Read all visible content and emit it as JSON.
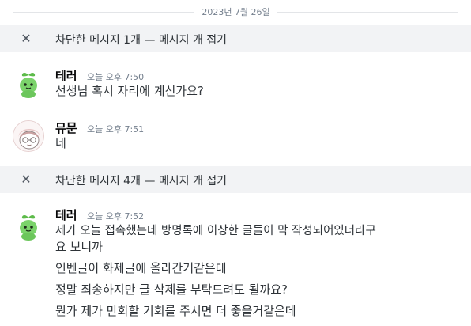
{
  "date_divider": "2023년 7월 26일",
  "blocked_1": {
    "text": "차단한 메시지 1개 — 메시지 개 접기"
  },
  "message_1": {
    "author": "테러",
    "timestamp": "오늘 오후 7:50",
    "lines": [
      "선생님 혹시 자리에 계신가요?"
    ],
    "avatar_icon": "green-sprout-avatar-icon"
  },
  "message_2": {
    "author": "뮤문",
    "timestamp": "오늘 오후 7:51",
    "lines": [
      "네"
    ],
    "avatar_icon": "sketch-character-avatar-icon"
  },
  "blocked_2": {
    "text": "차단한 메시지 4개 — 메시지 개 접기"
  },
  "message_3": {
    "author": "테러",
    "timestamp": "오늘 오후 7:52",
    "lines": [
      "제가 오늘 접속했는데 방명록에 이상한 글들이 막 작성되어있더라구",
      "요 보니까",
      "인벤글이 화제글에 올라간거같은데",
      "정말 죄송하지만 글 삭제를 부탁드려도 될까요?",
      "뭔가 제가 만회할 기회를 주시면 더 좋을거같은데"
    ],
    "avatar_icon": "green-sprout-avatar-icon"
  },
  "colors": {
    "blocked_bg": "#f2f3f5",
    "text": "#2e3338",
    "muted": "#747f8d",
    "avatar_green": "#7bd36b"
  }
}
